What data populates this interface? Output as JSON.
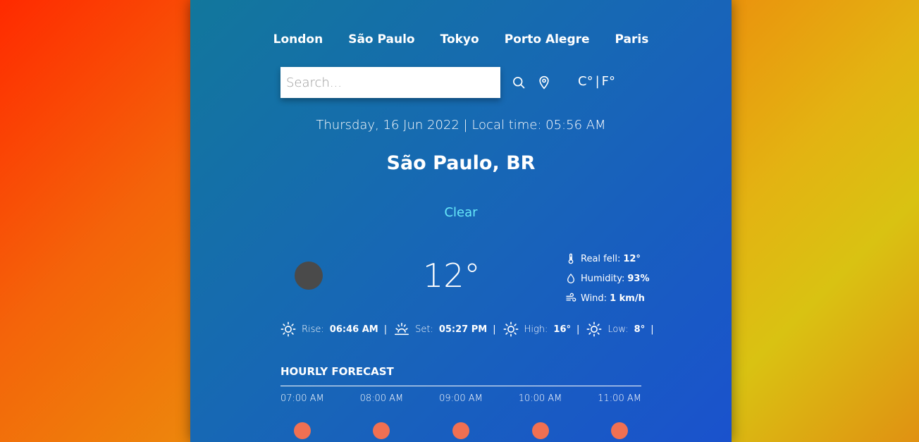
{
  "nav": [
    "London",
    "São Paulo",
    "Tokyo",
    "Porto Alegre",
    "Paris"
  ],
  "search": {
    "placeholder": "Search..."
  },
  "icons": {
    "search": "search-icon",
    "location": "location-pin-icon"
  },
  "units": {
    "celsius": "C°",
    "sep": "|",
    "fahrenheit": "F°"
  },
  "datetime": "Thursday, 16 Jun 2022 | Local time: 05:56 AM",
  "city": "São Paulo, BR",
  "condition": "Clear",
  "condition_color": "#67e8f9",
  "temperature": "12°",
  "details": {
    "real_feel_label": "Real fell:",
    "real_feel": "12°",
    "humidity_label": "Humidity:",
    "humidity": "93%",
    "wind_label": "Wind:",
    "wind": "1 km/h"
  },
  "sun": {
    "rise_label": "Rise:",
    "rise": "06:46 AM",
    "set_label": "Set:",
    "set": "05:27 PM",
    "high_label": "High:",
    "high": "16°",
    "low_label": "Low:",
    "low": "8°",
    "sep": "|"
  },
  "hourly": {
    "title": "HOURLY FORECAST",
    "items": [
      {
        "time": "07:00 AM"
      },
      {
        "time": "08:00 AM"
      },
      {
        "time": "09:00 AM"
      },
      {
        "time": "10:00 AM"
      },
      {
        "time": "11:00 AM"
      }
    ]
  }
}
